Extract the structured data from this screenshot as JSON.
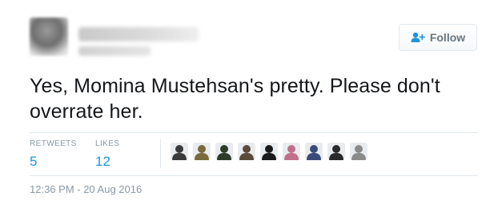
{
  "header": {
    "follow_label": "Follow",
    "follow_icon": "add-user-icon"
  },
  "tweet": {
    "line1": "Yes, Momina Mustehsan's pretty. Please don't",
    "line2": "overrate her."
  },
  "stats": {
    "retweets_label": "RETWEETS",
    "retweets_value": "5",
    "likes_label": "LIKES",
    "likes_value": "12"
  },
  "likers": [
    {
      "name": "liker-avatar-1",
      "color": "#3a3a3a"
    },
    {
      "name": "liker-avatar-2",
      "color": "#7a6a3a"
    },
    {
      "name": "liker-avatar-3",
      "color": "#2e3b2a"
    },
    {
      "name": "liker-avatar-4",
      "color": "#5a4a3a"
    },
    {
      "name": "liker-avatar-5",
      "color": "#1a1a1a"
    },
    {
      "name": "liker-avatar-6",
      "color": "#c0708a"
    },
    {
      "name": "liker-avatar-7",
      "color": "#3a4a7a"
    },
    {
      "name": "liker-avatar-8",
      "color": "#2a2a2a"
    },
    {
      "name": "liker-avatar-9",
      "color": "#8a8a8a"
    }
  ],
  "timestamp": "12:36 PM - 20 Aug 2016",
  "colors": {
    "link_blue": "#1b95e0",
    "muted_gray": "#8899a6",
    "divider": "#e1e8ed"
  }
}
